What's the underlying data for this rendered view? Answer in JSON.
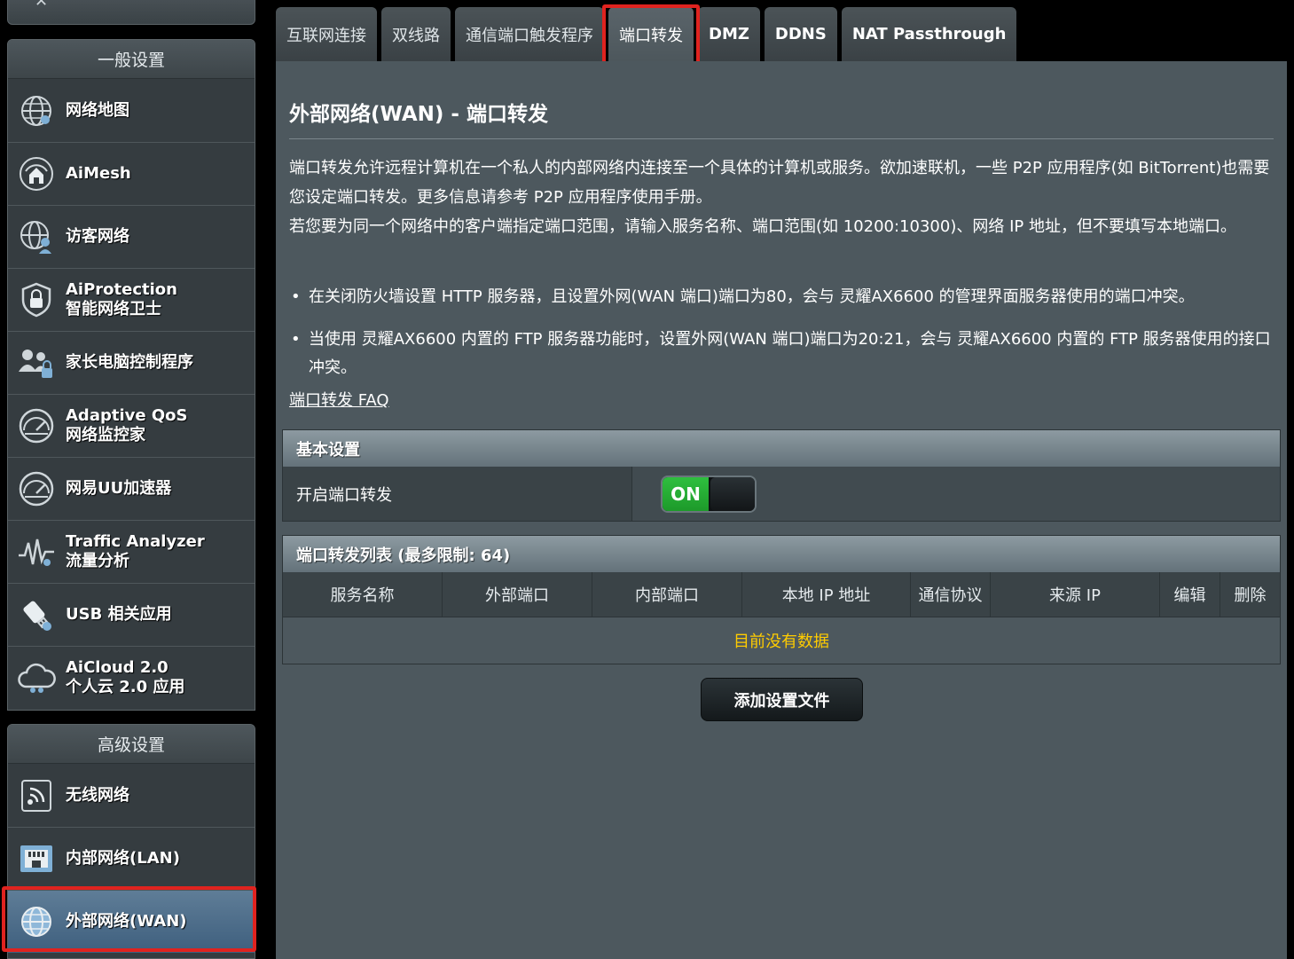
{
  "sidebar": {
    "general_header": "一般设置",
    "advanced_header": "高级设置",
    "items": [
      {
        "lines": [
          "网络地图"
        ],
        "icon": "globe-network-icon"
      },
      {
        "lines": [
          "AiMesh"
        ],
        "icon": "aimesh-home-icon"
      },
      {
        "lines": [
          "访客网络"
        ],
        "icon": "guest-network-icon"
      },
      {
        "lines": [
          "AiProtection",
          "智能网络卫士"
        ],
        "icon": "shield-lock-icon"
      },
      {
        "lines": [
          "家长电脑控制程序"
        ],
        "icon": "parental-control-icon"
      },
      {
        "lines": [
          "Adaptive QoS",
          "网络监控家"
        ],
        "icon": "speedometer-icon"
      },
      {
        "lines": [
          "网易UU加速器"
        ],
        "icon": "speedometer-icon"
      },
      {
        "lines": [
          "Traffic Analyzer",
          "流量分析"
        ],
        "icon": "traffic-wave-icon"
      },
      {
        "lines": [
          "USB 相关应用"
        ],
        "icon": "usb-icon"
      },
      {
        "lines": [
          "AiCloud 2.0",
          "个人云 2.0 应用"
        ],
        "icon": "cloud-icon"
      }
    ],
    "advanced_items": [
      {
        "lines": [
          "无线网络"
        ],
        "icon": "wireless-icon"
      },
      {
        "lines": [
          "内部网络(LAN)"
        ],
        "icon": "lan-port-icon"
      },
      {
        "lines": [
          "外部网络(WAN)"
        ],
        "icon": "globe-icon",
        "active": true
      }
    ]
  },
  "tabs": [
    {
      "label": "互联网连接"
    },
    {
      "label": "双线路"
    },
    {
      "label": "通信端口触发程序"
    },
    {
      "label": "端口转发",
      "active": true
    },
    {
      "label": "DMZ"
    },
    {
      "label": "DDNS"
    },
    {
      "label": "NAT Passthrough"
    }
  ],
  "page": {
    "title": "外部网络(WAN) - 端口转发",
    "desc_1": "端口转发允许远程计算机在一个私人的内部网络内连接至一个具体的计算机或服务。欲加速联机，一些 P2P 应用程序(如 BitTorrent)也需要您设定端口转发。更多信息请参考 P2P 应用程序使用手册。",
    "desc_2": "若您要为同一个网络中的客户端指定端口范围，请输入服务名称、端口范围(如 10200:10300)、网络 IP 地址，但不要填写本地端口。",
    "bullet_1": "在关闭防火墙设置 HTTP 服务器，且设置外网(WAN 端口)端口为80，会与 灵耀AX6600 的管理界面服务器使用的端口冲突。",
    "bullet_2": "当使用 灵耀AX6600 内置的 FTP 服务器功能时，设置外网(WAN 端口)端口为20:21，会与 灵耀AX6600 内置的 FTP 服务器使用的接口冲突。",
    "faq_link": "端口转发 FAQ"
  },
  "basic": {
    "header": "基本设置",
    "enable_label": "开启端口转发",
    "toggle_state": "ON",
    "toggle_color": "#28b035"
  },
  "list": {
    "header": "端口转发列表 (最多限制: 64)",
    "columns": [
      "服务名称",
      "外部端口",
      "内部端口",
      "本地 IP 地址",
      "通信协议",
      "来源 IP",
      "编辑",
      "删除"
    ],
    "empty_text": "目前没有数据",
    "empty_color": "#ffcc00"
  },
  "add_button": "添加设置文件",
  "colors": {
    "highlight": "#e0231f",
    "content_bg": "#4d585e",
    "active_menu": "#4a6a89"
  }
}
